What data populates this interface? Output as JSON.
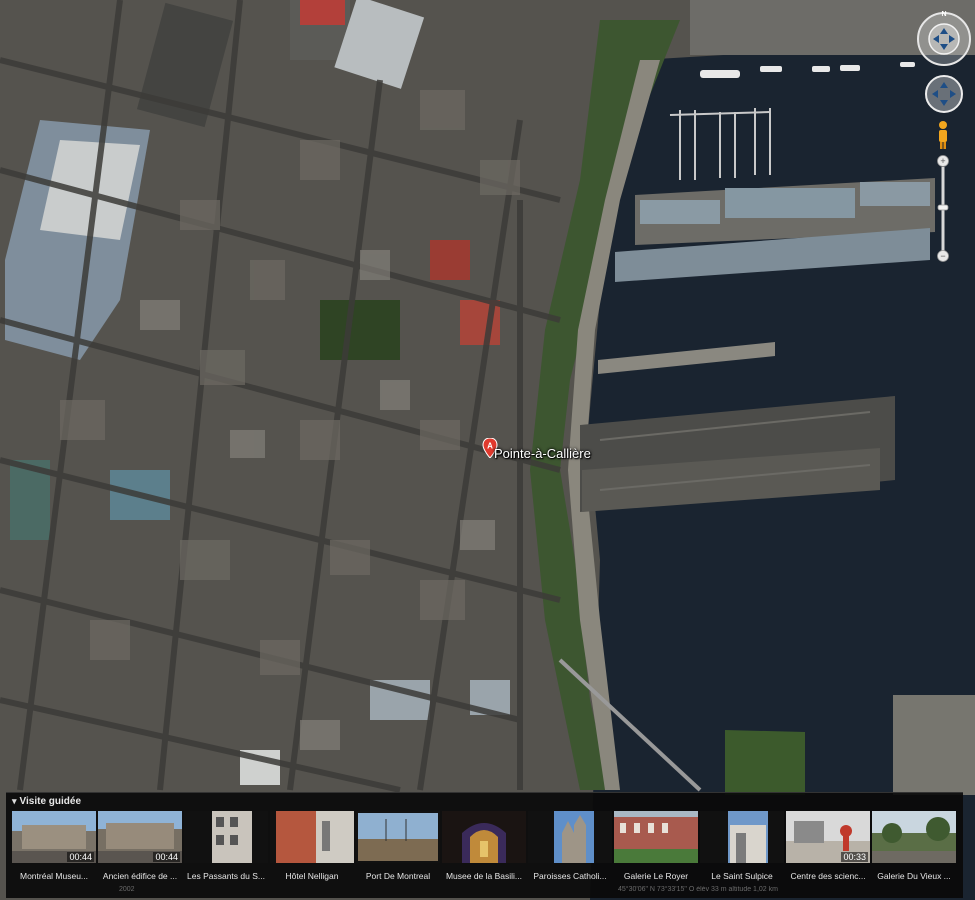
{
  "map": {
    "place_label": "Pointe-à-Callière",
    "marker_letter": "A",
    "compass_letter": "N"
  },
  "tour": {
    "title": "Visite guidée",
    "items": [
      {
        "label": "Montréal Museu...",
        "duration": "00:44"
      },
      {
        "label": "Ancien édifice de ...",
        "duration": "00:44"
      },
      {
        "label": "Les Passants du S...",
        "duration": ""
      },
      {
        "label": "Hôtel Nelligan",
        "duration": ""
      },
      {
        "label": "Port De Montreal",
        "duration": ""
      },
      {
        "label": "Musee de la Basili...",
        "duration": ""
      },
      {
        "label": "Paroisses Catholi...",
        "duration": ""
      },
      {
        "label": "Galerie Le Royer",
        "duration": ""
      },
      {
        "label": "Le Saint Sulpice",
        "duration": ""
      },
      {
        "label": "Centre des scienc...",
        "duration": "00:33"
      },
      {
        "label": "Galerie Du Vieux ...",
        "duration": ""
      }
    ],
    "footer_year": "2002",
    "footer_coords": "45°30'06\" N  73°33'15\" O  élév 33 m  altitude 1,02 km"
  },
  "colors": {
    "water": "#1a2530",
    "city": "#5a5a55",
    "pier": "#6e6e68",
    "park": "#3c5a2c",
    "marker": "#e03a2e"
  }
}
